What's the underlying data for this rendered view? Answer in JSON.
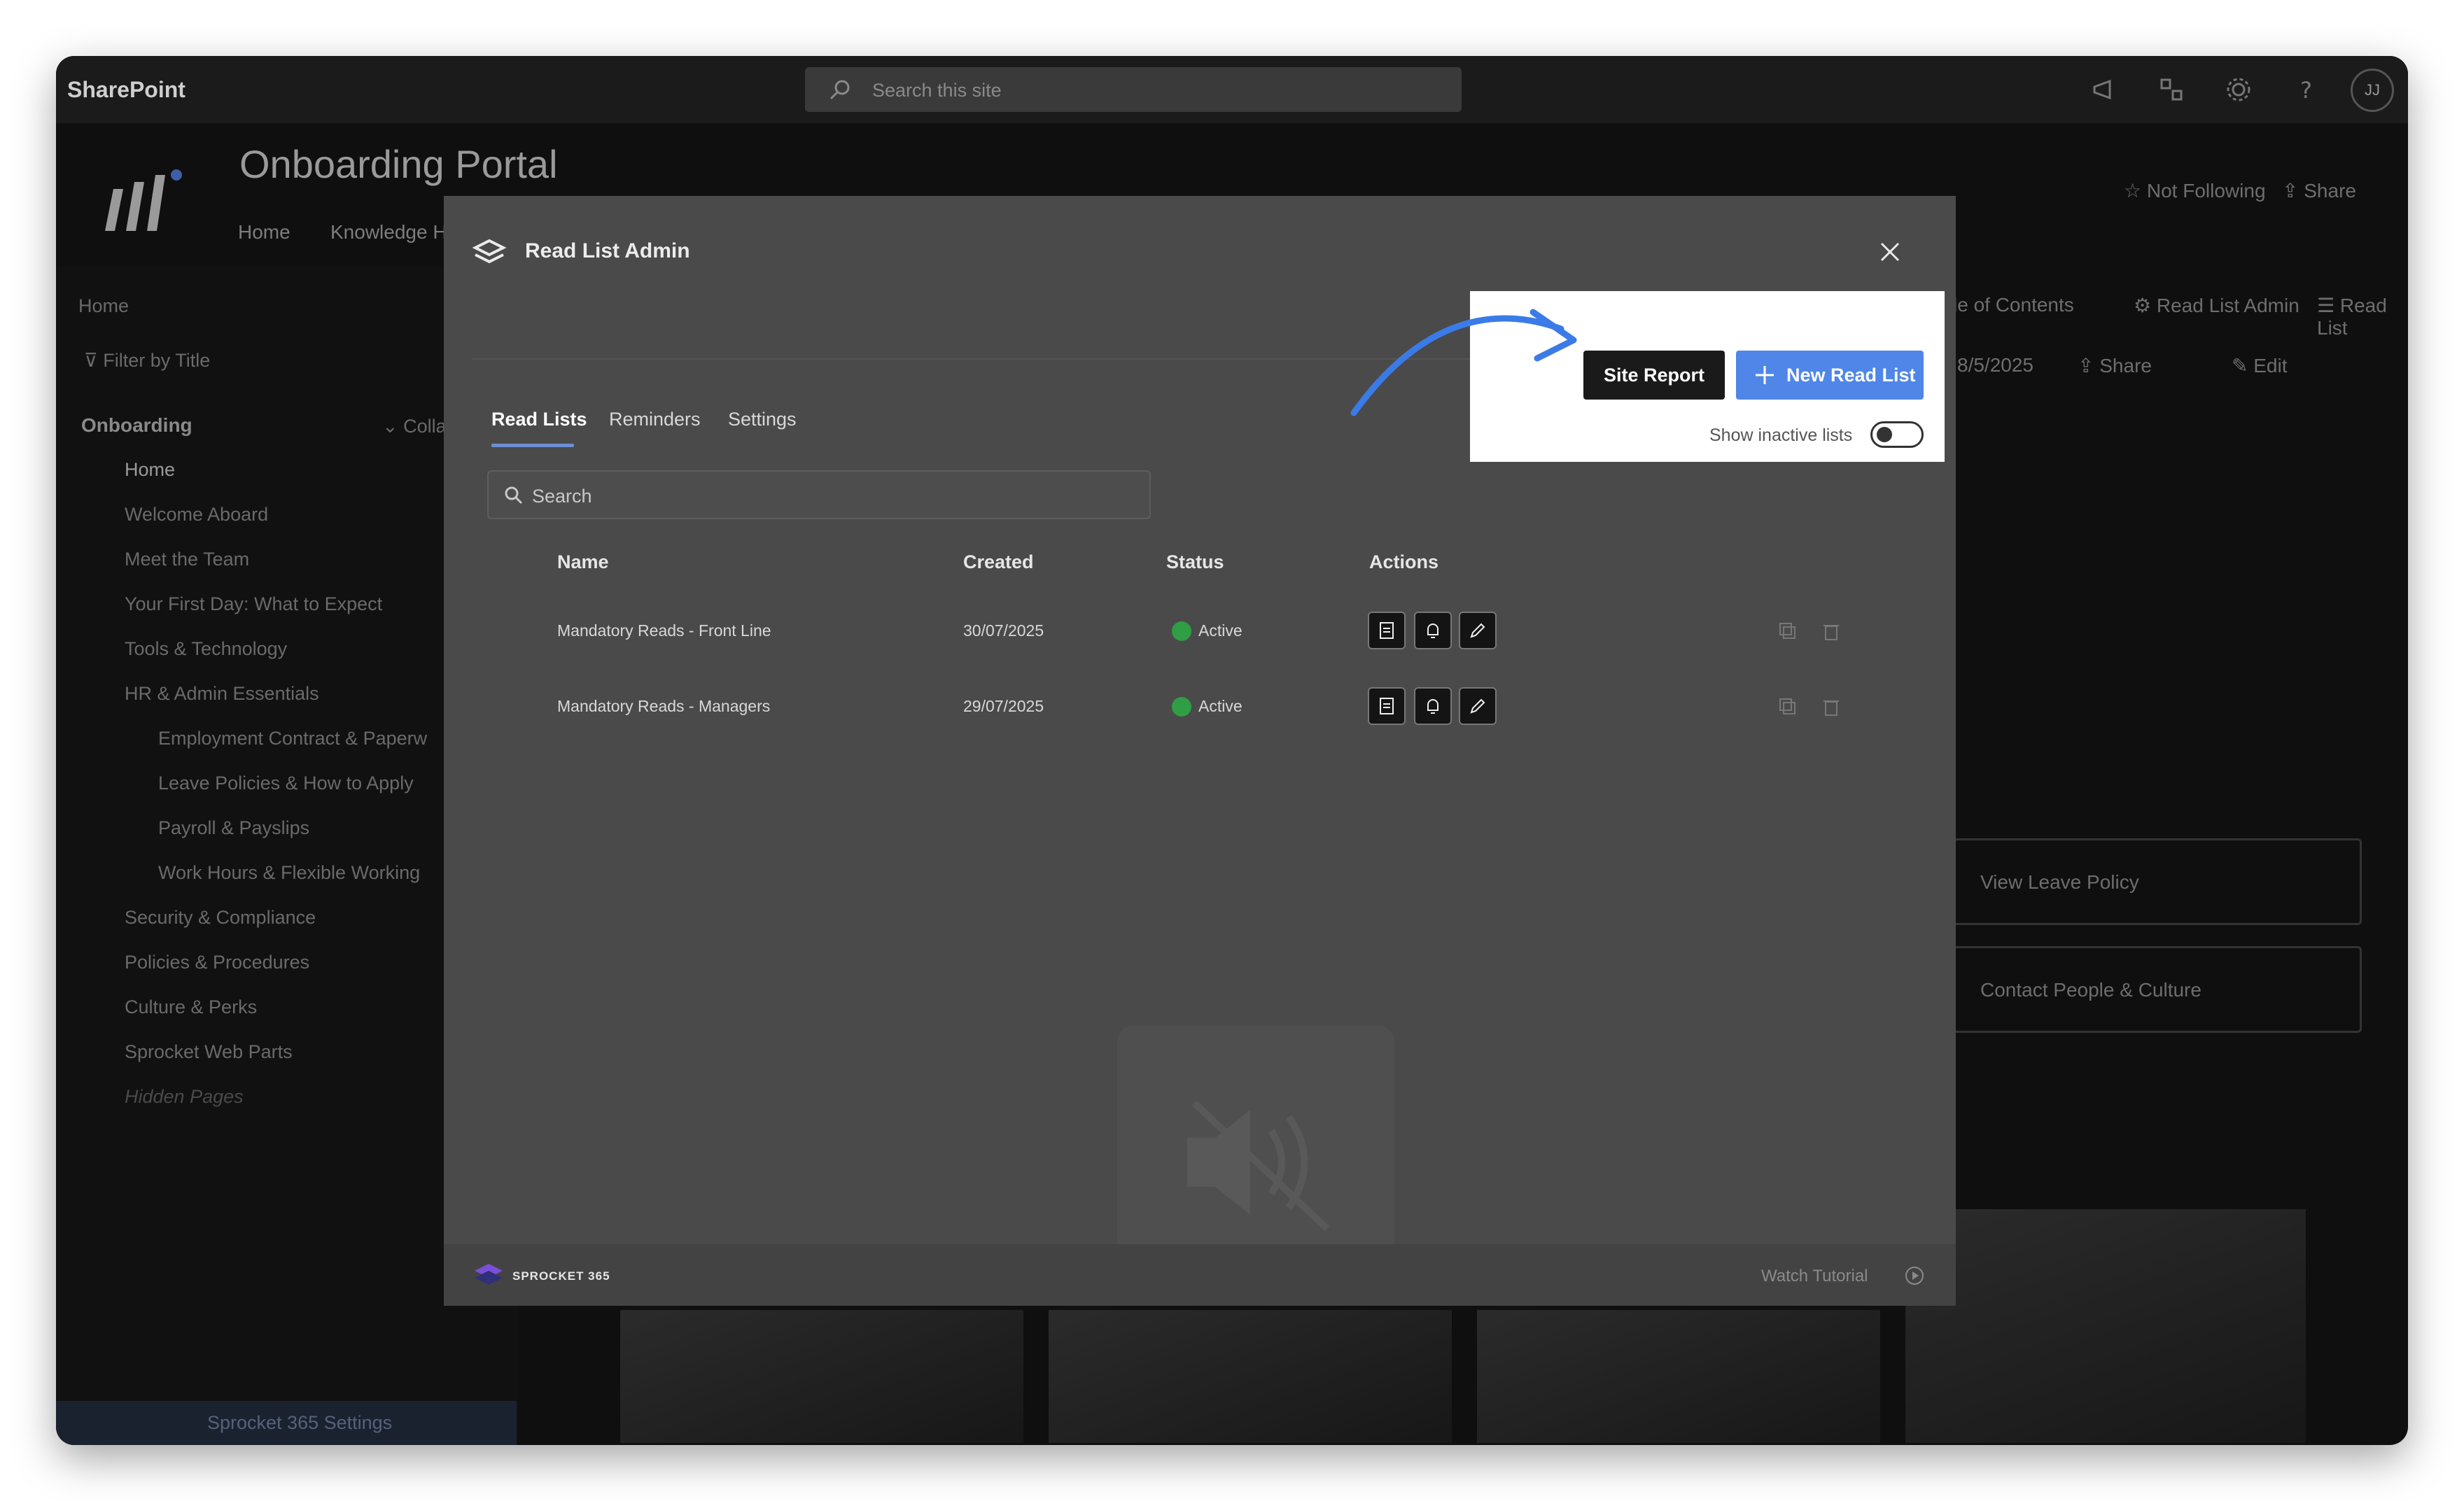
{
  "topbar": {
    "brand": "SharePoint",
    "search_placeholder": "Search this site",
    "avatar_initials": "JJ"
  },
  "site": {
    "title": "Onboarding Portal",
    "nav": [
      "Home",
      "Knowledge H"
    ],
    "not_following": "Not Following",
    "share": "Share",
    "toc": "le of Contents",
    "read_list_admin": "Read List Admin",
    "read_list": "Read List",
    "date": "8/5/2025",
    "share_cmd": "Share",
    "edit": "Edit"
  },
  "sidebar": {
    "home": "Home",
    "filter": "Filter by Title",
    "group": "Onboarding",
    "collapse": "Colla",
    "items": [
      "Home",
      "Welcome Aboard",
      "Meet the Team",
      "Your First Day: What to Expect",
      "Tools & Technology",
      "HR & Admin Essentials",
      "Employment Contract & Paperw",
      "Leave Policies & How to Apply",
      "Payroll & Payslips",
      "Work Hours & Flexible Working",
      "Security & Compliance",
      "Policies & Procedures",
      "Culture & Perks",
      "Sprocket Web Parts",
      "Hidden Pages"
    ],
    "footer": "Sprocket 365 Settings"
  },
  "cards": [
    "View Leave Policy",
    "Contact People & Culture"
  ],
  "modal": {
    "title": "Read List Admin",
    "tabs": [
      "Read Lists",
      "Reminders",
      "Settings"
    ],
    "search_placeholder": "Search",
    "columns": [
      "Name",
      "Created",
      "Status",
      "Actions"
    ],
    "rows": [
      {
        "name": "Mandatory Reads - Front Line",
        "created": "30/07/2025",
        "status": "Active"
      },
      {
        "name": "Mandatory Reads - Managers",
        "created": "29/07/2025",
        "status": "Active"
      }
    ],
    "site_report": "Site Report",
    "new_read_list": "New Read List",
    "show_inactive": "Show inactive lists",
    "footer_brand": "SPROCKET 365",
    "watch_tutorial": "Watch Tutorial"
  },
  "colors": {
    "primary": "#4f86e8",
    "active": "#2f9e44",
    "arrow": "#3b7be8"
  }
}
